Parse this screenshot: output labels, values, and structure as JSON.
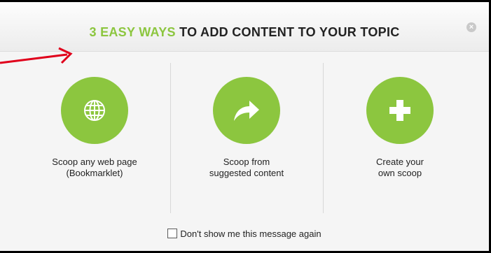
{
  "dialog": {
    "title_accent": "3 EASY WAYS",
    "title_rest": " TO ADD CONTENT TO YOUR TOPIC",
    "close_symbol": "×"
  },
  "options": [
    {
      "icon": "globe-icon",
      "line1": "Scoop any web page",
      "line2": "(Bookmarklet)"
    },
    {
      "icon": "share-arrow-icon",
      "line1": "Scoop from",
      "line2": "suggested content"
    },
    {
      "icon": "plus-icon",
      "line1": "Create your",
      "line2": "own scoop"
    }
  ],
  "footer": {
    "checkbox_label": "Don't show me this message again",
    "checked": false
  },
  "colors": {
    "accent": "#8cc63f",
    "annotation_arrow": "#e0001b"
  }
}
